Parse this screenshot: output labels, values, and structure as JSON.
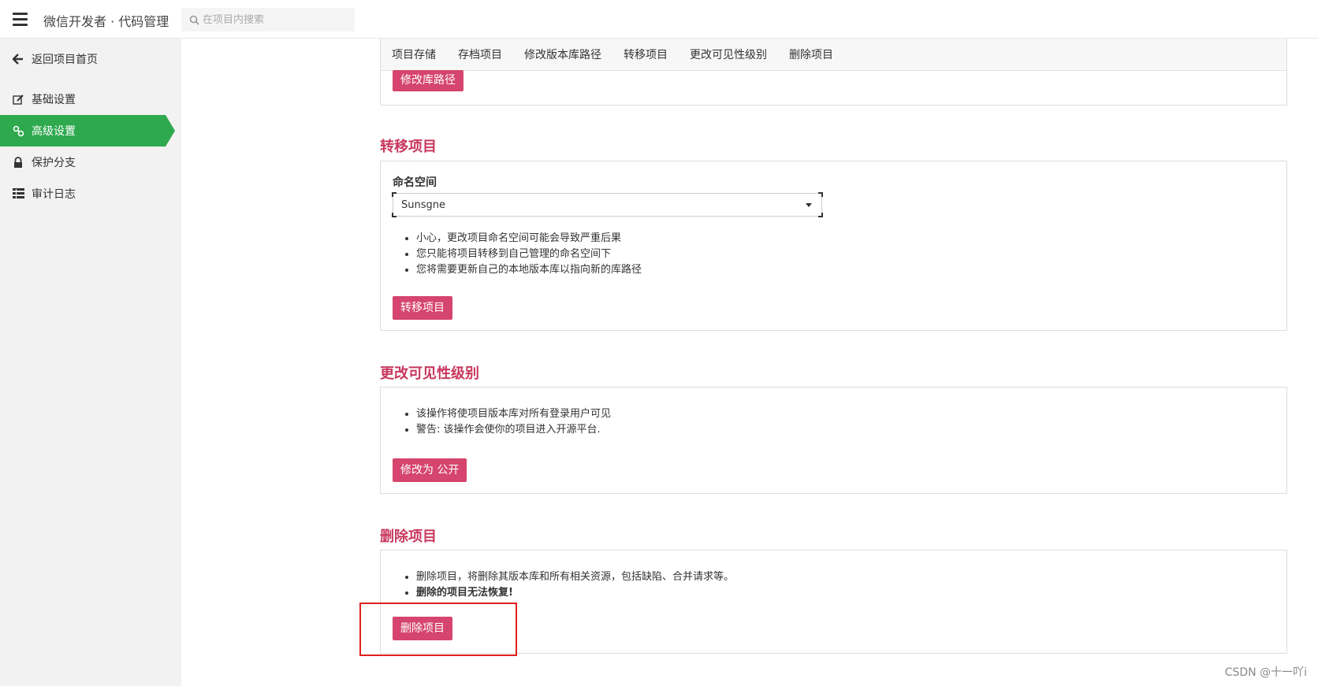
{
  "header": {
    "title": "微信开发者 · 代码管理",
    "search_placeholder": "在项目内搜索"
  },
  "sidebar": {
    "back": "返回项目首页",
    "items": [
      {
        "label": "基础设置",
        "icon": "edit-icon"
      },
      {
        "label": "高级设置",
        "icon": "link-icon",
        "active": true
      },
      {
        "label": "保护分支",
        "icon": "lock-icon"
      },
      {
        "label": "审计日志",
        "icon": "list-icon"
      }
    ]
  },
  "tabs": [
    "项目存储",
    "存档项目",
    "修改版本库路径",
    "转移项目",
    "更改可见性级别",
    "删除项目"
  ],
  "repo_path": {
    "button": "修改库路径"
  },
  "transfer": {
    "title": "转移项目",
    "namespace_label": "命名空间",
    "namespace_value": "Sunsgne",
    "notes": [
      "小心，更改项目命名空间可能会导致严重后果",
      "您只能将项目转移到自己管理的命名空间下",
      "您将需要更新自己的本地版本库以指向新的库路径"
    ],
    "button": "转移项目"
  },
  "visibility": {
    "title": "更改可见性级别",
    "notes": [
      "该操作将使项目版本库对所有登录用户可见",
      "警告: 该操作会使你的项目进入开源平台."
    ],
    "button": "修改为 公开"
  },
  "delete": {
    "title": "删除项目",
    "notes": [
      "删除项目，将删除其版本库和所有相关资源，包括缺陷、合并请求等。",
      "删除的项目无法恢复!"
    ],
    "button": "删除项目"
  },
  "watermark": "CSDN @十一吖i",
  "colors": {
    "accent_green": "#2ea94e",
    "danger": "#d5456e",
    "title_red": "#c8385e",
    "highlight": "#e02020"
  }
}
